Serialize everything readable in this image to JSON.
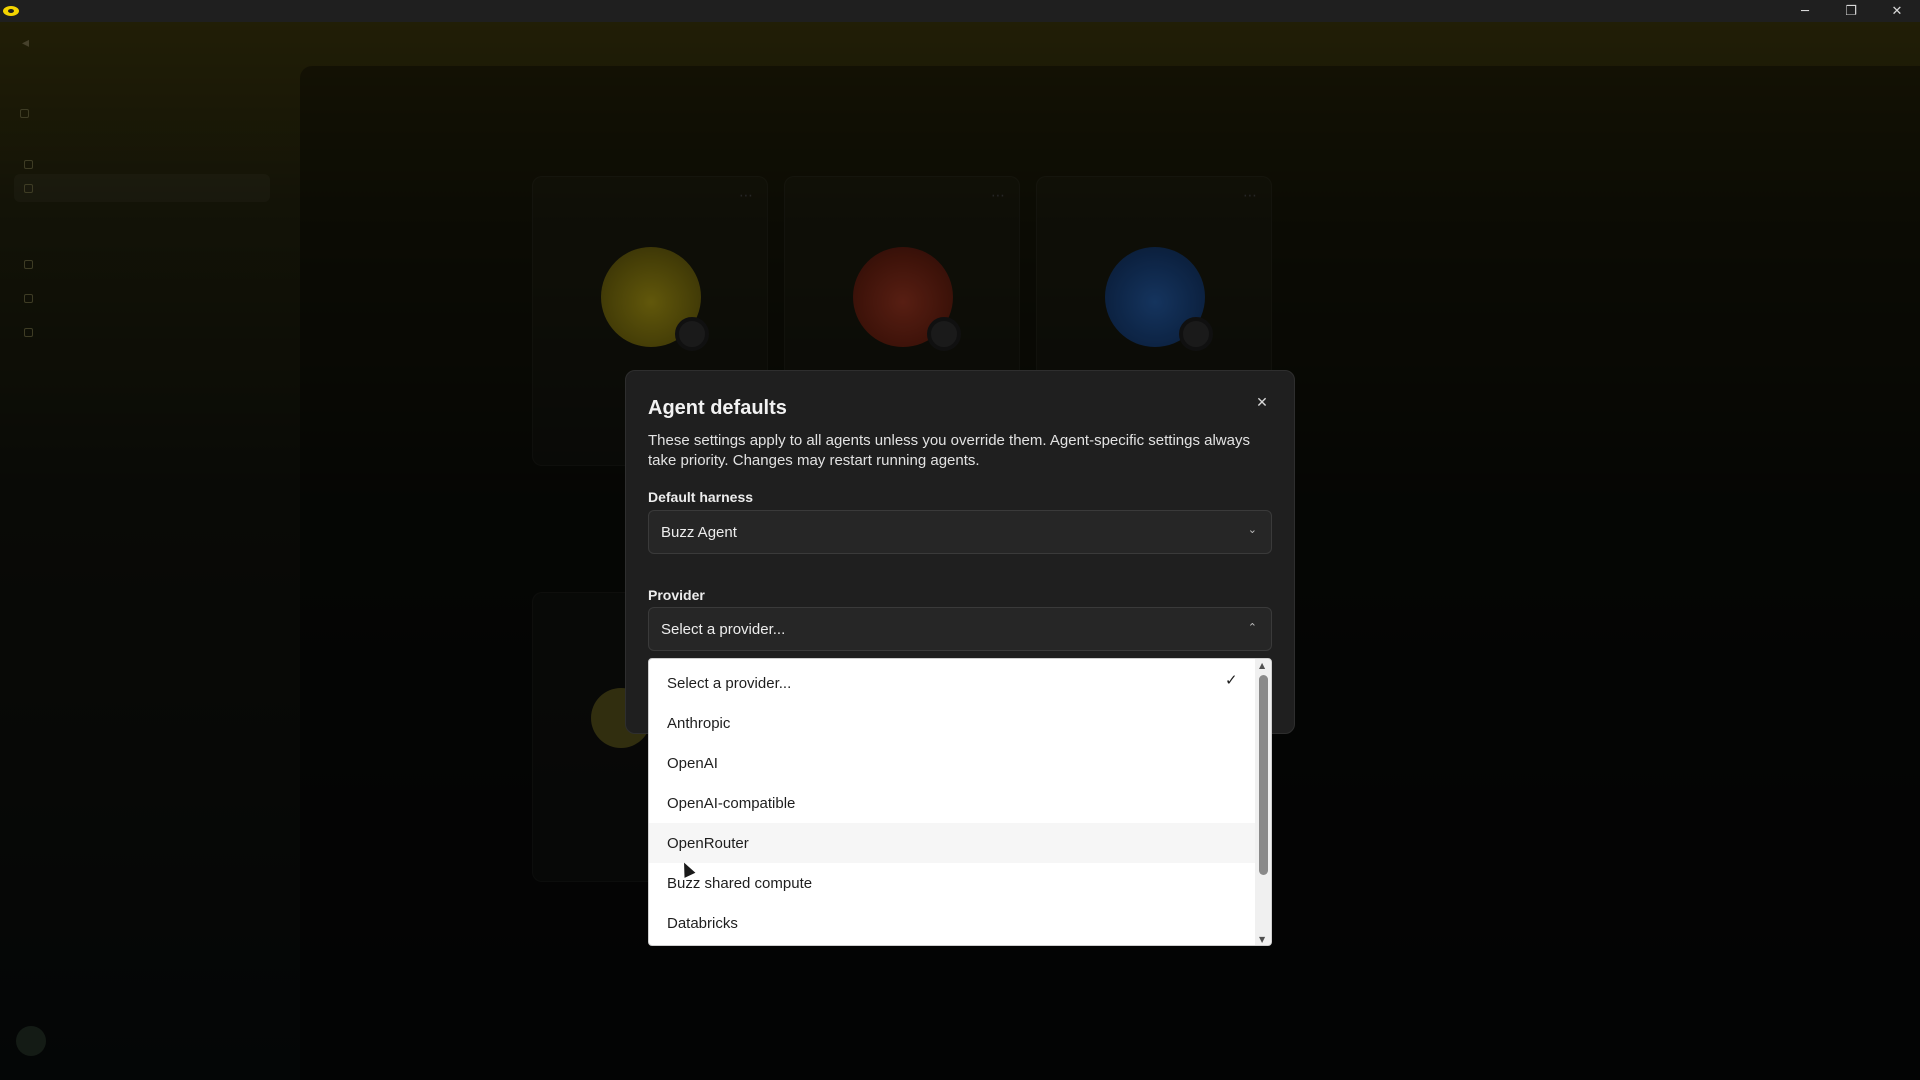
{
  "window": {
    "controls": {
      "minimize": "─",
      "maximize": "❐",
      "close": "✕"
    }
  },
  "dialog": {
    "title": "Agent defaults",
    "close_icon": "✕",
    "description": "These settings apply to all agents unless you override them. Agent-specific settings always take priority. Changes may restart running agents.",
    "harness": {
      "label": "Default harness",
      "value": "Buzz Agent"
    },
    "provider": {
      "label": "Provider",
      "value": "Select a provider...",
      "options": [
        {
          "label": "Select a provider...",
          "selected": true
        },
        {
          "label": "Anthropic",
          "selected": false
        },
        {
          "label": "OpenAI",
          "selected": false
        },
        {
          "label": "OpenAI-compatible",
          "selected": false
        },
        {
          "label": "OpenRouter",
          "selected": false
        },
        {
          "label": "Buzz shared compute",
          "selected": false
        },
        {
          "label": "Databricks",
          "selected": false
        }
      ]
    }
  },
  "colors": {
    "accent_yellow": "#f4d400",
    "dialog_bg": "#1f1f1f",
    "dropdown_bg": "#ffffff"
  }
}
